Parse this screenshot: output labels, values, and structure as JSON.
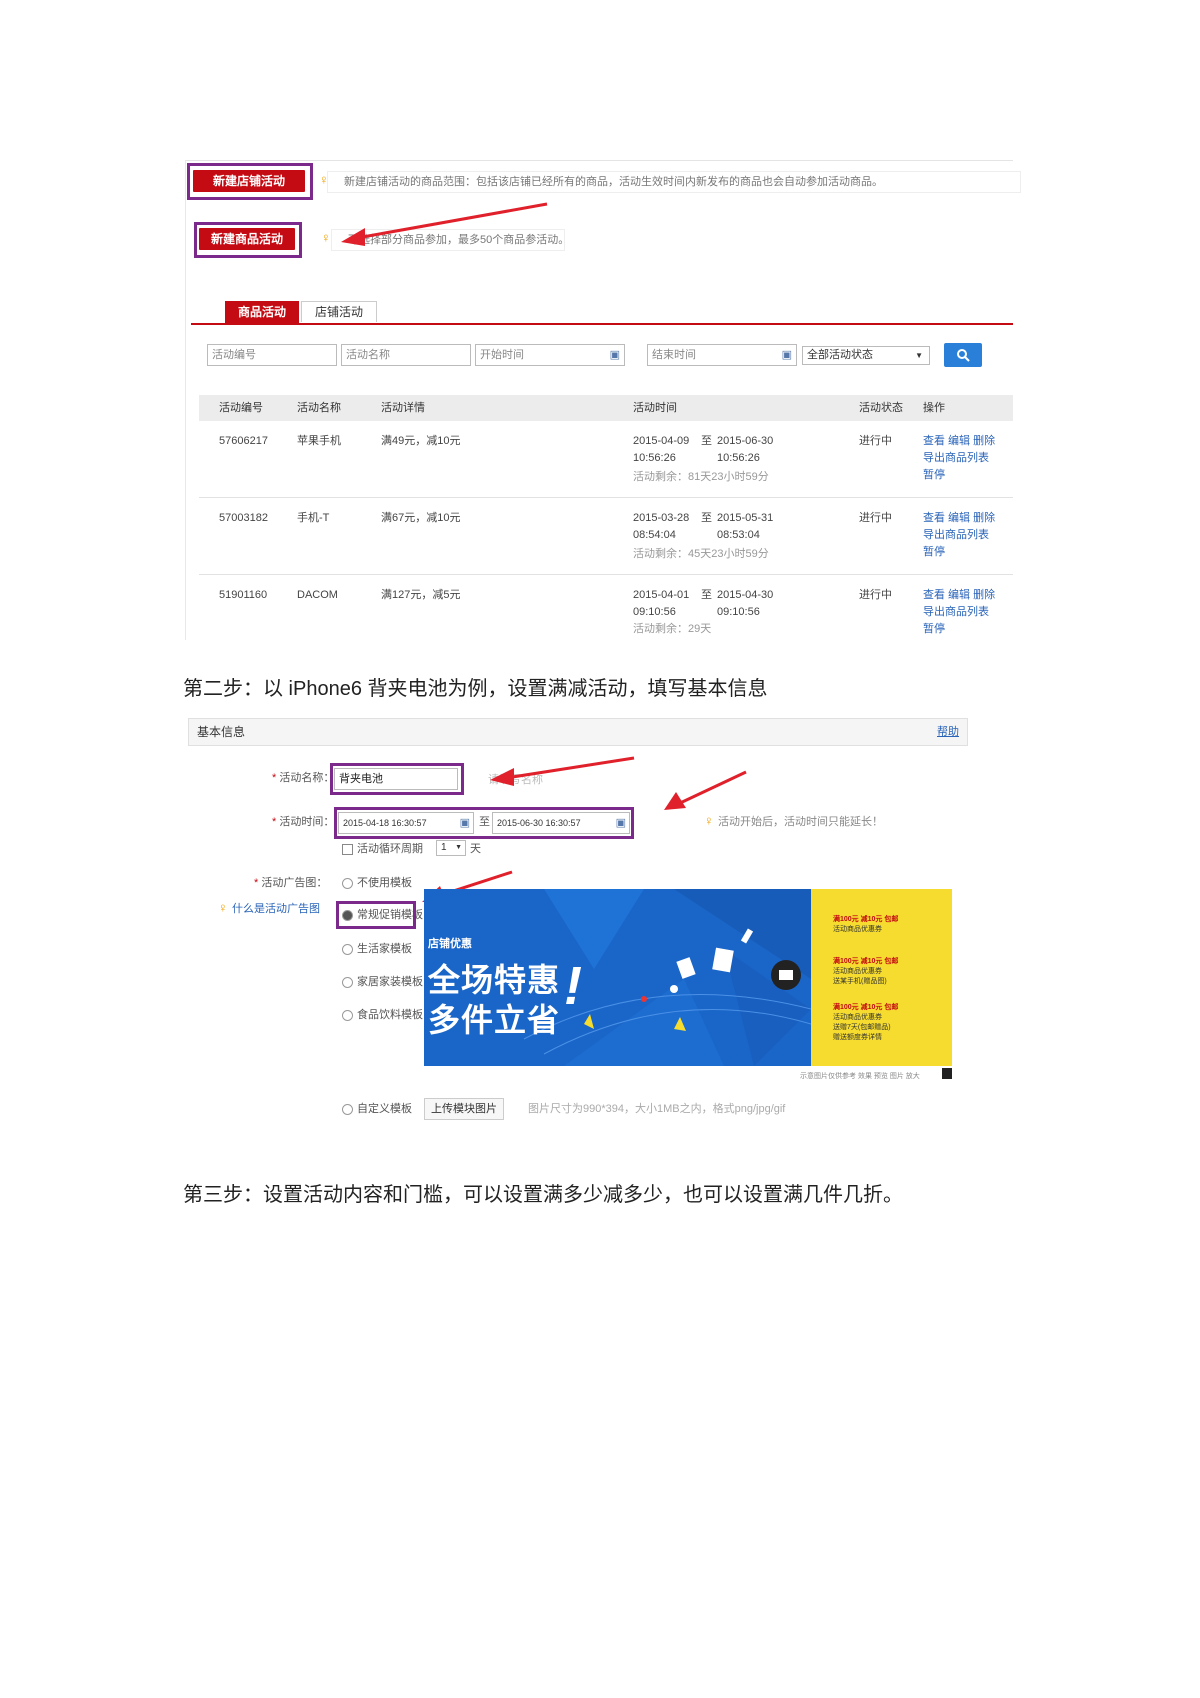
{
  "shot1": {
    "new_shop_button": "新建店铺活动",
    "new_shop_tip": "新建店铺活动的商品范围：包括该店铺已经所有的商品，活动生效时间内新发布的商品也会自动参加活动商品。",
    "new_item_button": "新建商品活动",
    "new_item_tip": "可选择部分商品参加，最多50个商品参活动。",
    "tabs": [
      "商品活动",
      "店铺活动"
    ],
    "filters": {
      "id_placeholder": "活动编号",
      "name_placeholder": "活动名称",
      "start_placeholder": "开始时间",
      "end_placeholder": "结束时间",
      "status_value": "全部活动状态",
      "status_caret": "▼"
    },
    "columns": [
      "活动编号",
      "活动名称",
      "活动详情",
      "活动时间",
      "活动状态",
      "操作"
    ],
    "rows": [
      {
        "id": "57606217",
        "name": "苹果手机",
        "detail": "满49元，减10元",
        "start_date": "2015-04-09",
        "start_time": "10:56:26",
        "to": "至",
        "end_date": "2015-06-30",
        "end_time": "10:56:26",
        "remaining": "活动剩余：81天23小时59分",
        "status": "进行中",
        "actions1": "查看 编辑 删除",
        "actions2": "导出商品列表",
        "actions3": "暂停"
      },
      {
        "id": "57003182",
        "name": "手机-T",
        "detail": "满67元，减10元",
        "start_date": "2015-03-28",
        "start_time": "08:54:04",
        "to": "至",
        "end_date": "2015-05-31",
        "end_time": "08:53:04",
        "remaining": "活动剩余：45天23小时59分",
        "status": "进行中",
        "actions1": "查看 编辑 删除",
        "actions2": "导出商品列表",
        "actions3": "暂停"
      },
      {
        "id": "51901160",
        "name": "DACOM",
        "detail": "满127元，减5元",
        "start_date": "2015-04-01",
        "start_time": "09:10:56",
        "to": "至",
        "end_date": "2015-04-30",
        "end_time": "09:10:56",
        "remaining": "活动剩余：29天",
        "status": "进行中",
        "actions1": "查看 编辑 删除",
        "actions2": "导出商品列表",
        "actions3": "暂停"
      }
    ]
  },
  "step2_heading": "第二步：以 iPhone6 背夹电池为例，设置满减活动，填写基本信息",
  "shot2": {
    "header_title": "基本信息",
    "header_help": "帮助",
    "name_label": "活动名称：",
    "name_value": "背夹电池",
    "name_hint": "请填写名称",
    "time_label": "活动时间：",
    "start_value": "2015-04-18 16:30:57",
    "time_sep": "至",
    "end_value": "2015-06-30 16:30:57",
    "time_tip": "活动开始后，活动时间只能延长！",
    "repeat_label": "活动循环周期",
    "repeat_value": "1",
    "repeat_unit": "天",
    "ad_label": "活动广告图：",
    "ad_options": [
      "不使用模板",
      "常规促销模板",
      "生活家模板",
      "家居家装模板",
      "食品饮料模板"
    ],
    "ad_tip": "什么是活动广告图",
    "custom_label": "自定义模板",
    "upload_button": "上传模块图片",
    "upload_tip": "图片尺寸为990*394，大小1MB之内，格式png/jpg/gif",
    "banner": {
      "brand": "店铺优惠",
      "line1": "全场特惠",
      "line2": "多件立省",
      "coupons": [
        {
          "title": "满100元 减10元 包邮",
          "sub": "活动商品优惠券"
        },
        {
          "title": "满100元 减10元 包邮",
          "sub": "活动商品优惠券",
          "sub2": "送某手机(赠品图)"
        },
        {
          "title": "满100元 减10元 包邮",
          "sub": "活动商品优惠券",
          "sub2": "送赠7天(包邮赠品)",
          "sub3": "赠送额度券详情"
        }
      ],
      "caption": "示意图片仅供参考 效果 预览 图片 放大"
    }
  },
  "step3_heading": "第三步：设置活动内容和门槛，可以设置满多少减多少，也可以设置满几件几折。",
  "colors": {
    "brand_red": "#c40a12",
    "highlight_purple": "#7b2a8c",
    "link_blue": "#2a64b8",
    "banner_blue": "#1a66c8",
    "banner_yellow": "#f6dc2e"
  }
}
